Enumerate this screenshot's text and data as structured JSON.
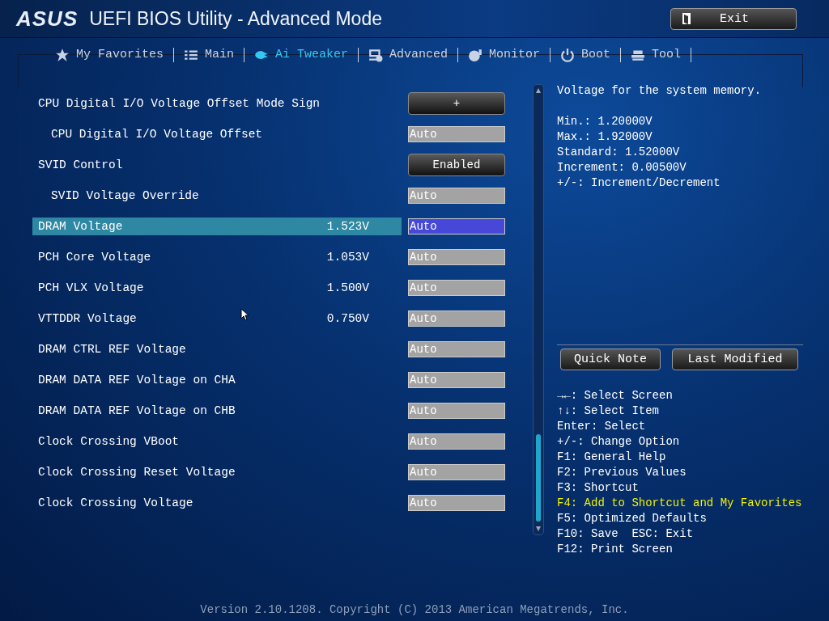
{
  "header": {
    "logo": "ASUS",
    "title": "UEFI BIOS Utility - Advanced Mode",
    "exit_button": "Exit"
  },
  "tabs": [
    {
      "label": "My Favorites",
      "selected": false
    },
    {
      "label": "Main",
      "selected": false
    },
    {
      "label": "Ai Tweaker",
      "selected": true
    },
    {
      "label": "Advanced",
      "selected": false
    },
    {
      "label": "Monitor",
      "selected": false
    },
    {
      "label": "Boot",
      "selected": false
    },
    {
      "label": "Tool",
      "selected": false
    }
  ],
  "settings": [
    {
      "label": "CPU Digital I/O Voltage Offset Mode Sign",
      "kind": "button",
      "value": "+",
      "selected": false,
      "children": [
        {
          "label": "CPU Digital I/O Voltage Offset",
          "kind": "field",
          "value": "Auto",
          "selected": false
        }
      ]
    },
    {
      "label": "SVID Control",
      "kind": "button",
      "value": "Enabled",
      "selected": false,
      "children": [
        {
          "label": "SVID Voltage Override",
          "kind": "field",
          "value": "Auto",
          "selected": false
        }
      ]
    },
    {
      "label": "DRAM Voltage",
      "reading": "1.523V",
      "kind": "field",
      "value": "Auto",
      "selected": true
    },
    {
      "label": "PCH Core Voltage",
      "reading": "1.053V",
      "kind": "field",
      "value": "Auto",
      "selected": false
    },
    {
      "label": "PCH VLX Voltage",
      "reading": "1.500V",
      "kind": "field",
      "value": "Auto",
      "selected": false
    },
    {
      "label": "VTTDDR Voltage",
      "reading": "0.750V",
      "kind": "field",
      "value": "Auto",
      "selected": false
    },
    {
      "label": "DRAM CTRL REF Voltage",
      "kind": "field",
      "value": "Auto",
      "selected": false
    },
    {
      "label": "DRAM DATA REF Voltage on CHA",
      "kind": "field",
      "value": "Auto",
      "selected": false
    },
    {
      "label": "DRAM DATA REF Voltage on CHB",
      "kind": "field",
      "value": "Auto",
      "selected": false
    },
    {
      "label": "Clock Crossing VBoot",
      "kind": "field",
      "value": "Auto",
      "selected": false
    },
    {
      "label": "Clock Crossing Reset Voltage",
      "kind": "field",
      "value": "Auto",
      "selected": false
    },
    {
      "label": "Clock Crossing Voltage",
      "kind": "field",
      "value": "Auto",
      "selected": false
    }
  ],
  "help": {
    "description": "Voltage for the system memory.",
    "details": [
      "Min.: 1.20000V",
      "Max.: 1.92000V",
      "Standard: 1.52000V",
      "Increment: 0.00500V",
      "+/-: Increment/Decrement"
    ],
    "buttons": [
      "Quick Note",
      "Last Modified"
    ],
    "keys": [
      {
        "text": "→←: Select Screen",
        "highlighted": false
      },
      {
        "text": "↑↓: Select Item",
        "highlighted": false
      },
      {
        "text": "Enter: Select",
        "highlighted": false
      },
      {
        "text": "+/-: Change Option",
        "highlighted": false
      },
      {
        "text": "F1: General Help",
        "highlighted": false
      },
      {
        "text": "F2: Previous Values",
        "highlighted": false
      },
      {
        "text": "F3: Shortcut",
        "highlighted": false
      },
      {
        "text": "F4: Add to Shortcut and My Favorites",
        "highlighted": true
      },
      {
        "text": "F5: Optimized Defaults",
        "highlighted": false
      },
      {
        "text": "F10: Save  ESC: Exit",
        "highlighted": false
      },
      {
        "text": "F12: Print Screen",
        "highlighted": false
      }
    ]
  },
  "footer": "Version 2.10.1208. Copyright (C) 2013 American Megatrends, Inc."
}
